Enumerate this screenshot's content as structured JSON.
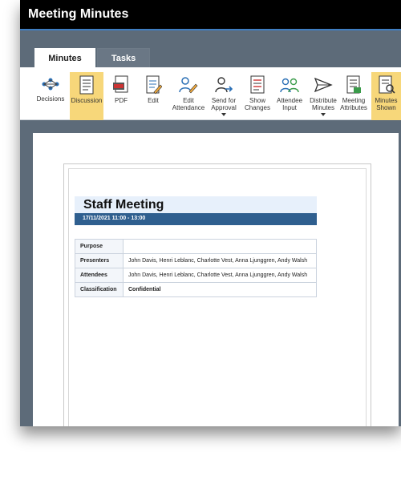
{
  "app": {
    "title": "Meeting Minutes"
  },
  "tabs": [
    {
      "label": "Minutes",
      "active": true
    },
    {
      "label": "Tasks",
      "active": false
    }
  ],
  "ribbon": {
    "decisions": "Decisions",
    "discussion": "Discussion",
    "pdf": "PDF",
    "edit": "Edit",
    "edit_attendance": [
      "Edit",
      "Attendance"
    ],
    "send_for_approval": [
      "Send for",
      "Approval"
    ],
    "show_changes": [
      "Show",
      "Changes"
    ],
    "attendee_input": [
      "Attendee",
      "Input"
    ],
    "distribute_minutes": [
      "Distribute",
      "Minutes"
    ],
    "meeting_attributes": [
      "Meeting",
      "Attributes"
    ],
    "minutes_shown": [
      "Minutes",
      "Shown"
    ]
  },
  "colors": {
    "accent": "#f7d77a",
    "header_blue": "#2f5f8f",
    "titlebar": "#000000",
    "app_bg": "#5d6b79"
  },
  "document": {
    "title": "Staff Meeting",
    "date": "17/11/2021 11:00 - 13:00",
    "rows": [
      {
        "label": "Purpose",
        "value": ""
      },
      {
        "label": "Presenters",
        "value": "John Davis, Henri Leblanc, Charlotte Vest, Anna Ljunggren, Andy Walsh"
      },
      {
        "label": "Attendees",
        "value": "John Davis, Henri Leblanc, Charlotte Vest, Anna Ljunggren, Andy Walsh"
      },
      {
        "label": "Classification",
        "value": "Confidential"
      }
    ]
  }
}
